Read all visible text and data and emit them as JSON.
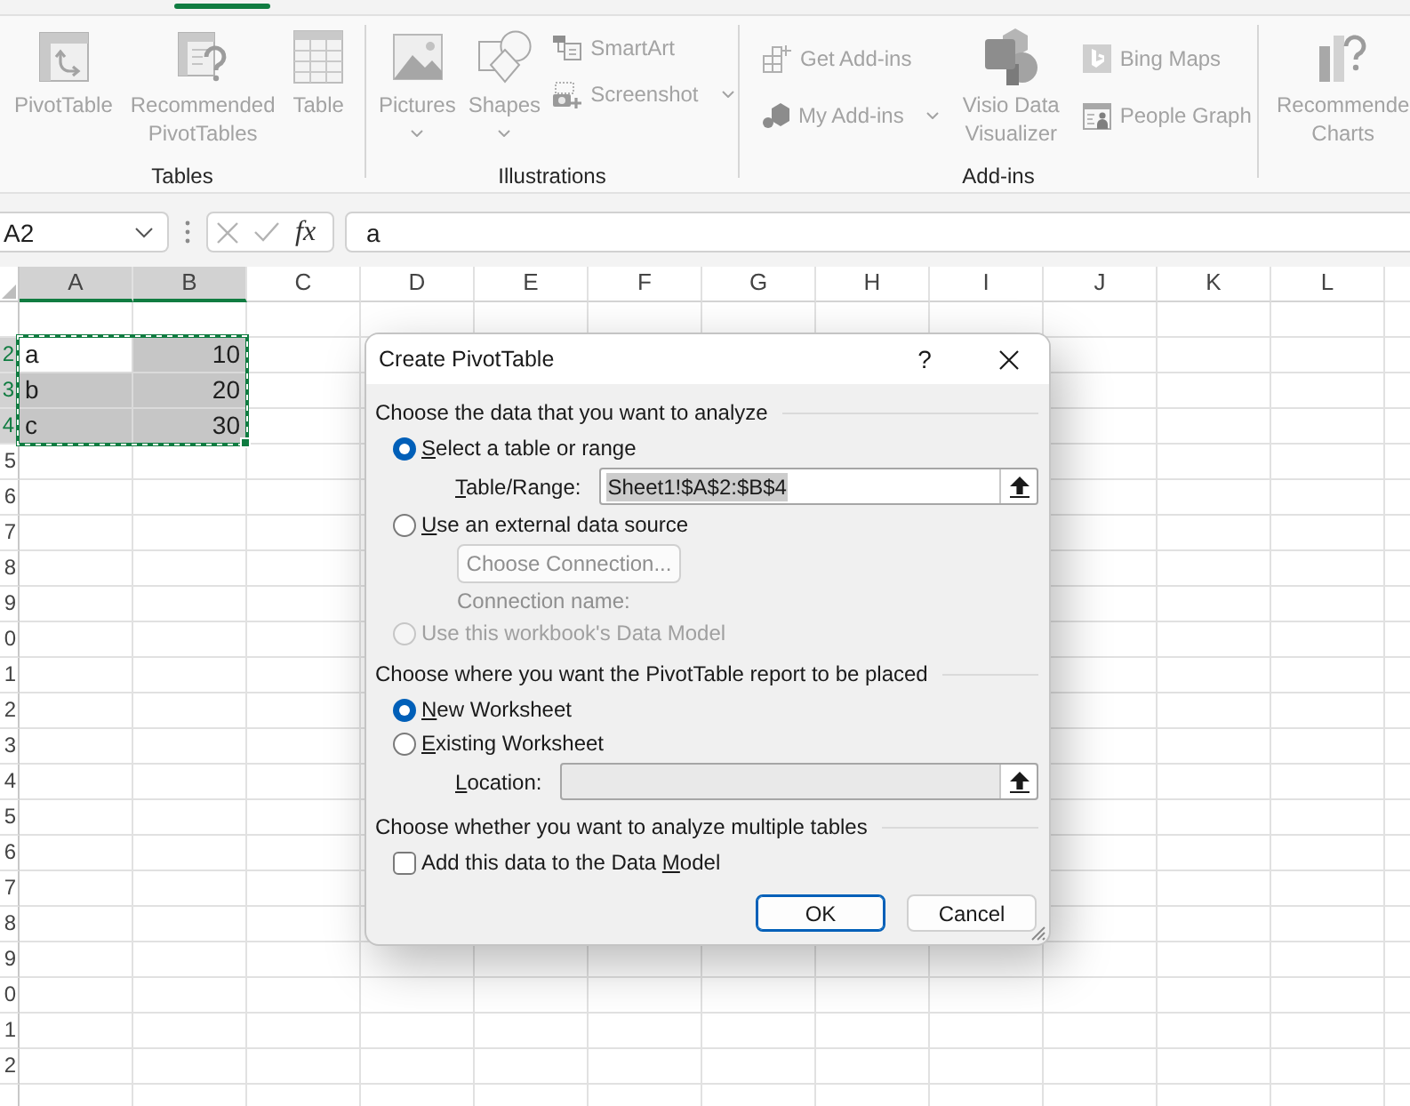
{
  "tab_strip": {
    "active_tab_underline": true
  },
  "ribbon": {
    "groups": [
      {
        "label": "Tables",
        "columns": [
          {
            "kind": "large",
            "lines": [
              "PivotTable"
            ],
            "disabled": true
          },
          {
            "kind": "large",
            "lines": [
              "Recommended",
              "PivotTables"
            ],
            "disabled": true
          },
          {
            "kind": "large",
            "lines": [
              "Table"
            ],
            "disabled": true
          }
        ]
      },
      {
        "label": "Illustrations",
        "columns": [
          {
            "kind": "large",
            "lines": [
              "Pictures"
            ],
            "dropdown": true,
            "disabled": true
          },
          {
            "kind": "large",
            "lines": [
              "Shapes"
            ],
            "dropdown": true,
            "disabled": true
          },
          {
            "kind": "stack",
            "items": [
              {
                "label": "SmartArt",
                "disabled": true
              },
              {
                "label": "Screenshot",
                "dropdown": true,
                "disabled": true
              }
            ]
          }
        ]
      },
      {
        "label": "Add-ins",
        "columns": [
          {
            "kind": "pair",
            "items": [
              {
                "label": "Get Add-ins",
                "disabled": true
              },
              {
                "label": "My Add-ins",
                "dropdown": true,
                "disabled": true
              }
            ]
          },
          {
            "kind": "large",
            "lines": [
              "Visio Data",
              "Visualizer"
            ],
            "disabled": true
          },
          {
            "kind": "pair",
            "items": [
              {
                "label": "Bing Maps",
                "disabled": true
              },
              {
                "label": "People Graph",
                "disabled": true
              }
            ]
          }
        ]
      },
      {
        "columns": [
          {
            "kind": "large",
            "lines": [
              "Recommende",
              "Charts"
            ],
            "disabled": true
          }
        ]
      }
    ]
  },
  "formula_bar": {
    "name_box": "A2",
    "function_label": "fx",
    "formula": "a"
  },
  "sheet": {
    "columns": [
      {
        "label": "A",
        "selected": true
      },
      {
        "label": "B",
        "selected": true
      },
      {
        "label": "C",
        "selected": false
      },
      {
        "label": "D",
        "selected": false
      },
      {
        "label": "E",
        "selected": false
      },
      {
        "label": "F",
        "selected": false
      },
      {
        "label": "G",
        "selected": false
      },
      {
        "label": "H",
        "selected": false
      },
      {
        "label": "I",
        "selected": false
      },
      {
        "label": "J",
        "selected": false
      },
      {
        "label": "K",
        "selected": false
      },
      {
        "label": "L",
        "selected": false
      }
    ],
    "rows": [
      {
        "selected": false
      },
      {
        "header": "2",
        "selected": true,
        "cells": [
          {
            "kind": "text",
            "value": "a",
            "active": true
          },
          {
            "kind": "number",
            "value": "10",
            "active": false
          }
        ]
      },
      {
        "header": "3",
        "selected": true,
        "cells": [
          {
            "kind": "text",
            "value": "b",
            "active": false
          },
          {
            "kind": "number",
            "value": "20",
            "active": false
          }
        ]
      },
      {
        "header": "4",
        "selected": true,
        "cells": [
          {
            "kind": "text",
            "value": "c",
            "active": false
          },
          {
            "kind": "number",
            "value": "30",
            "active": false
          }
        ]
      },
      {
        "header": "5",
        "selected": false
      },
      {
        "header": "6",
        "selected": false
      },
      {
        "header": "7",
        "selected": false
      },
      {
        "header": "8",
        "selected": false
      },
      {
        "header": "9",
        "selected": false
      },
      {
        "header": "0",
        "selected": false
      },
      {
        "header": "1",
        "selected": false
      },
      {
        "header": "2",
        "selected": false
      },
      {
        "header": "3",
        "selected": false
      },
      {
        "header": "4",
        "selected": false
      },
      {
        "header": "5",
        "selected": false
      },
      {
        "header": "6",
        "selected": false
      },
      {
        "header": "7",
        "selected": false
      },
      {
        "header": "8",
        "selected": false
      },
      {
        "header": "9",
        "selected": false
      },
      {
        "header": "0",
        "selected": false
      },
      {
        "header": "1",
        "selected": false
      },
      {
        "header": "2",
        "selected": false
      },
      {
        "selected": false
      }
    ]
  },
  "dialog": {
    "title": "Create PivotTable",
    "help": "?",
    "sections": [
      {
        "heading": "Choose the data that you want to analyze",
        "items": [
          {
            "kind": "radio",
            "label": {
              "key": "S",
              "post": "elect a table or range"
            },
            "selected": true,
            "disabled": false
          },
          {
            "kind": "field",
            "label": {
              "key": "T",
              "post": "able/Range:"
            },
            "value": "Sheet1!$A$2:$B$4",
            "value_selected": true,
            "disabled": false
          },
          {
            "kind": "radio",
            "label": {
              "key": "U",
              "post": "se an external data source"
            },
            "selected": false,
            "disabled": false
          },
          {
            "kind": "button",
            "label": "Choose Connection...",
            "disabled": true
          },
          {
            "kind": "note",
            "label": "Connection name:",
            "disabled": true
          },
          {
            "kind": "radio",
            "label": {
              "pre": "Use this workbook's Data Model"
            },
            "selected": false,
            "disabled": true
          }
        ]
      },
      {
        "heading": "Choose where you want the PivotTable report to be placed",
        "items": [
          {
            "kind": "radio",
            "label": {
              "key": "N",
              "post": "ew Worksheet"
            },
            "selected": true,
            "disabled": false
          },
          {
            "kind": "radio",
            "label": {
              "key": "E",
              "post": "xisting Worksheet"
            },
            "selected": false,
            "disabled": false
          },
          {
            "kind": "field",
            "label": {
              "key": "L",
              "post": "ocation:"
            },
            "disabled": true
          }
        ]
      },
      {
        "heading": "Choose whether you want to analyze multiple tables",
        "items": [
          {
            "kind": "checkbox",
            "label": {
              "pre": "Add this data to the Data ",
              "key": "M",
              "post": "odel"
            },
            "checked": false
          }
        ]
      }
    ],
    "buttons": [
      {
        "label": "OK",
        "default": true
      },
      {
        "label": "Cancel",
        "default": false
      }
    ]
  }
}
